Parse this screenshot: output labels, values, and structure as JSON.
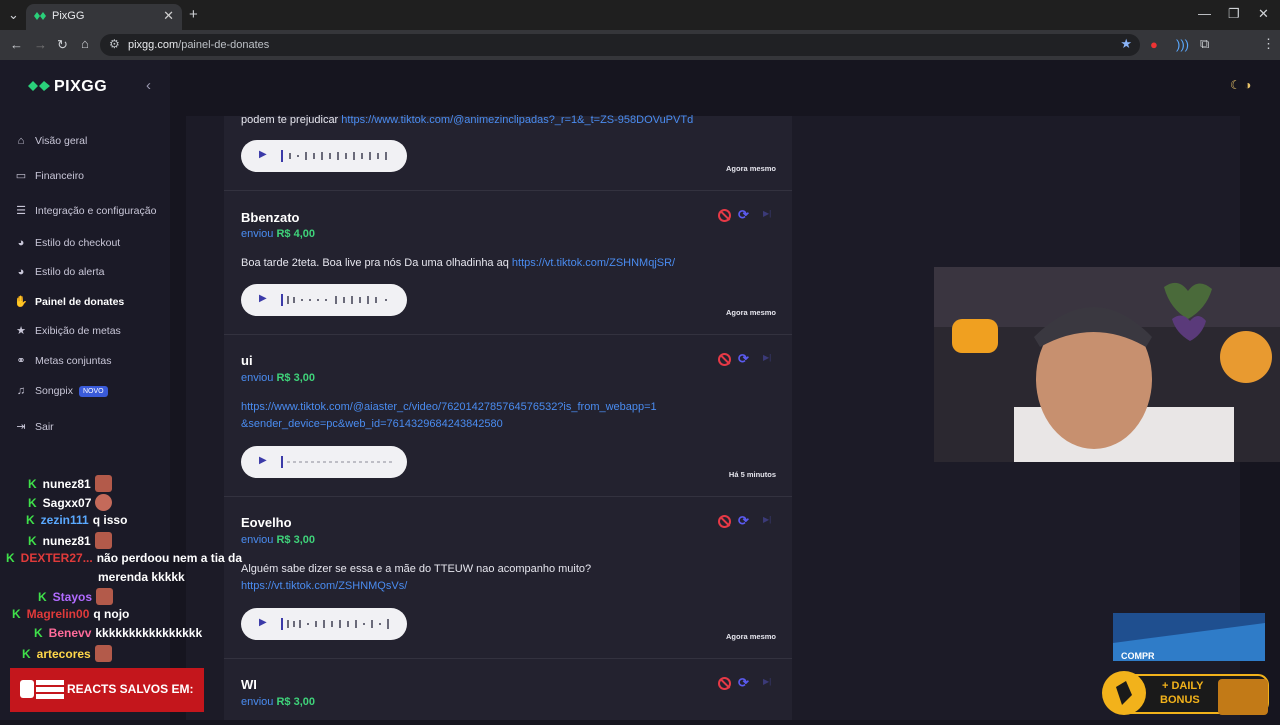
{
  "browser": {
    "tab_title": "PixGG",
    "url_host": "pixgg.com",
    "url_path": "/painel-de-donates"
  },
  "sidebar": {
    "brand": "PIXGG",
    "items": [
      {
        "label": "Visão geral",
        "icon": "home-icon"
      },
      {
        "label": "Financeiro",
        "icon": "wallet-icon"
      },
      {
        "label": "Integração e configuração",
        "icon": "settings-doc-icon"
      },
      {
        "label": "Estilo do checkout",
        "icon": "palette-icon"
      },
      {
        "label": "Estilo do alerta",
        "icon": "palette-icon"
      },
      {
        "label": "Painel de donates",
        "icon": "donate-icon",
        "active": true
      },
      {
        "label": "Exibição de metas",
        "icon": "star-icon"
      },
      {
        "label": "Metas conjuntas",
        "icon": "link-icon"
      },
      {
        "label": "Songpix",
        "icon": "music-icon",
        "badge": "NOVO"
      },
      {
        "label": "Sair",
        "icon": "logout-icon"
      }
    ]
  },
  "donates": {
    "sent_label": "enviou",
    "items": [
      {
        "name": "",
        "amount": "",
        "message": "podem te prejudicar ",
        "link": "https://www.tiktok.com/@animezinclipadas?_r=1&_t=ZS-958DOVuPVTd",
        "time": "Agora mesmo"
      },
      {
        "name": "Bbenzato",
        "amount": "R$ 4,00",
        "message": "Boa tarde 2teta. Boa live pra nós Da uma olhadinha aq ",
        "link": "https://vt.tiktok.com/ZSHNMqjSR/",
        "time": "Agora mesmo"
      },
      {
        "name": "ui",
        "amount": "R$ 3,00",
        "message": "",
        "link": "https://www.tiktok.com/@aiaster_c/video/7620142785764576532?is_from_webapp=1&sender_device=pc&web_id=7614329684243842580",
        "time": "Há 5 minutos"
      },
      {
        "name": "Eovelho",
        "amount": "R$ 3,00",
        "message": "Alguém sabe dizer se essa e a mãe do TTEUW nao acompanho muito? ",
        "link": "https://vt.tiktok.com/ZSHNMQsVs/",
        "time": "Agora mesmo"
      },
      {
        "name": "WI",
        "amount": "R$ 3,00",
        "message": "",
        "link": "",
        "time": ""
      }
    ]
  },
  "chat": [
    {
      "user": "nunez81",
      "color": "#ffffff",
      "msg": ""
    },
    {
      "user": "Sagxx07",
      "color": "#ffffff",
      "msg": ""
    },
    {
      "user": "zezin111",
      "color": "#5aa9ff",
      "msg": "q isso"
    },
    {
      "user": "nunez81",
      "color": "#ffffff",
      "msg": ""
    },
    {
      "user": "DEXTER27...",
      "color": "#e03a3a",
      "msg": "não perdoou nem a tia da"
    },
    {
      "user": "",
      "color": "#ffffff",
      "msg": "merenda kkkkk"
    },
    {
      "user": "Stayos",
      "color": "#b26bff",
      "msg": ""
    },
    {
      "user": "Magrelin00",
      "color": "#e03a3a",
      "msg": "q nojo"
    },
    {
      "user": "Benevv",
      "color": "#ff6b9a",
      "msg": "kkkkkkkkkkkkkkkk"
    },
    {
      "user": "artecores",
      "color": "#ffd84a",
      "msg": ""
    }
  ],
  "overlays": {
    "reacts_banner": "REACTS SALVOS EM:",
    "bonus_line1": "+ DAILY",
    "bonus_line2": "BONUS",
    "promo_text": "COMPR"
  },
  "colors": {
    "accent": "#3fd37a",
    "link": "#4a8cf0",
    "danger": "#e63946"
  }
}
